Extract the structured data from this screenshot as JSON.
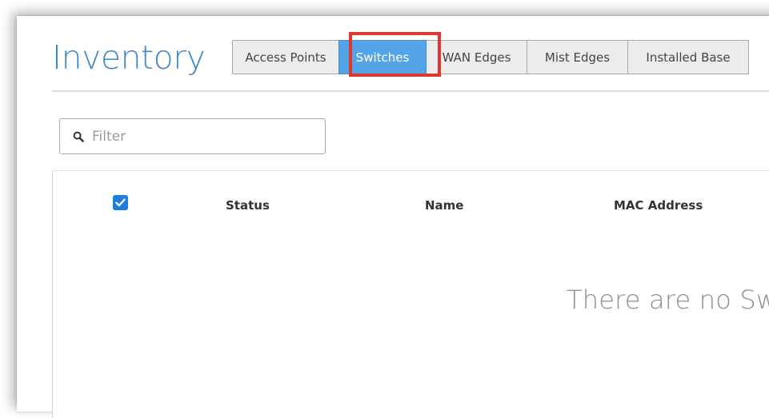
{
  "page": {
    "title": "Inventory"
  },
  "tabs": [
    {
      "label": "Access Points",
      "active": false
    },
    {
      "label": "Switches",
      "active": true
    },
    {
      "label": "WAN Edges",
      "active": false
    },
    {
      "label": "Mist Edges",
      "active": false
    },
    {
      "label": "Installed Base",
      "active": false
    }
  ],
  "filter": {
    "placeholder": "Filter",
    "value": "",
    "icon": "search-icon"
  },
  "table": {
    "select_all_checked": true,
    "columns": [
      "Status",
      "Name",
      "MAC Address"
    ],
    "empty_message": "There are no Sw"
  },
  "colors": {
    "title": "#4389c8",
    "active_tab": "#55a4e8",
    "highlight": "#e0372c",
    "checkbox": "#1e7ee0"
  }
}
